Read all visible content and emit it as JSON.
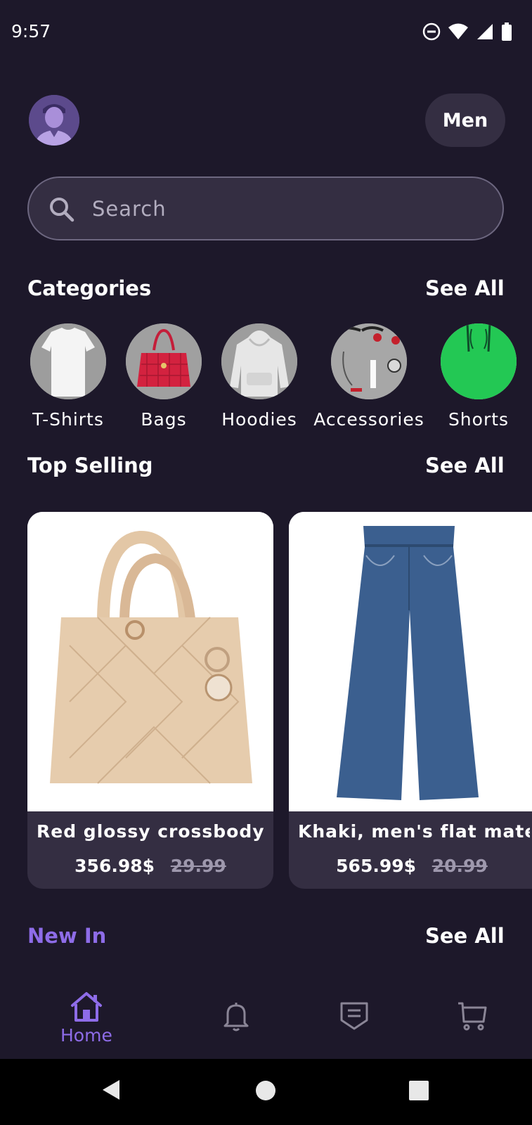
{
  "status_bar": {
    "time": "9:57"
  },
  "header": {
    "gender_label": "Men"
  },
  "search": {
    "placeholder": "Search"
  },
  "categories": {
    "title": "Categories",
    "see_all": "See All",
    "items": [
      {
        "label": "T-Shirts",
        "icon": "tshirt-image"
      },
      {
        "label": "Bags",
        "icon": "bag-image"
      },
      {
        "label": "Hoodies",
        "icon": "hoodie-image"
      },
      {
        "label": "Accessories",
        "icon": "accessories-image"
      },
      {
        "label": "Shorts",
        "icon": "shorts-image"
      }
    ]
  },
  "top_selling": {
    "title": "Top Selling",
    "see_all": "See All",
    "products": [
      {
        "name": "Red glossy crossbody ...",
        "price": "356.98$",
        "old_price": "29.99",
        "image": "handbag-image"
      },
      {
        "name": "Khaki, men's flat mate...",
        "price": "565.99$",
        "old_price": "20.99",
        "image": "jeans-image"
      }
    ]
  },
  "new_in": {
    "title": "New In",
    "see_all": "See All",
    "title_color": "#8e6ce8"
  },
  "bottom_nav": {
    "items": [
      {
        "label": "Home",
        "icon": "home-icon",
        "active": true
      },
      {
        "label": "",
        "icon": "bell-icon",
        "active": false
      },
      {
        "label": "",
        "icon": "orders-icon",
        "active": false
      },
      {
        "label": "",
        "icon": "cart-icon",
        "active": false
      }
    ]
  },
  "colors": {
    "background": "#1d182a",
    "surface": "#342e42",
    "accent": "#8e6ce8"
  }
}
